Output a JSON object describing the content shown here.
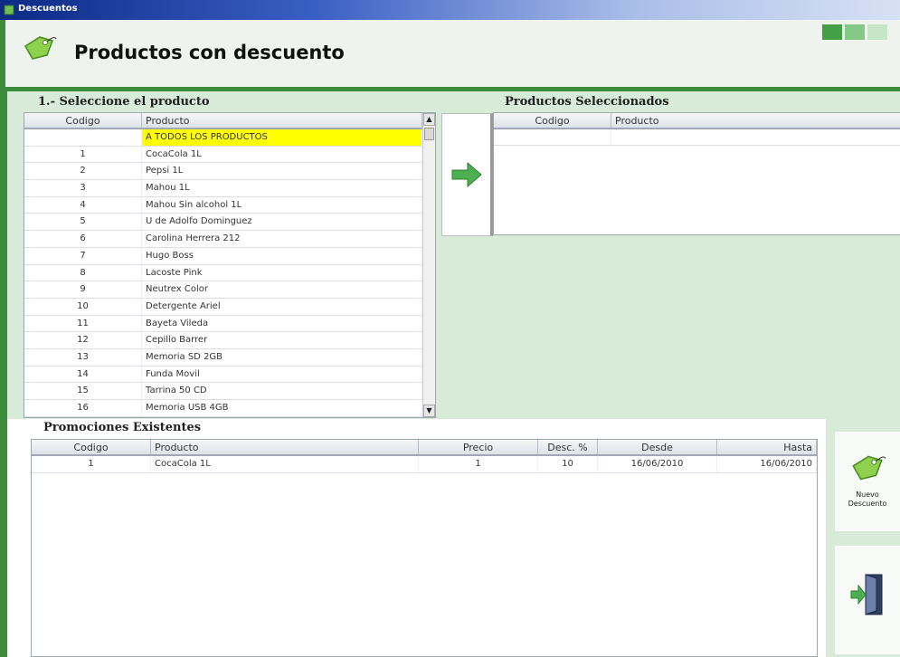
{
  "window": {
    "title": "Descuentos"
  },
  "header": {
    "title": "Productos con descuento"
  },
  "left_section": {
    "label": "1.- Seleccione el producto",
    "columns": [
      "Codigo",
      "Producto"
    ],
    "rows": [
      {
        "code": "",
        "product": "A TODOS LOS PRODUCTOS",
        "highlight": true
      },
      {
        "code": "1",
        "product": "CocaCola 1L"
      },
      {
        "code": "2",
        "product": "Pepsi 1L"
      },
      {
        "code": "3",
        "product": "Mahou 1L"
      },
      {
        "code": "4",
        "product": "Mahou Sin alcohol 1L"
      },
      {
        "code": "5",
        "product": "U de Adolfo Dominguez"
      },
      {
        "code": "6",
        "product": "Carolina Herrera 212"
      },
      {
        "code": "7",
        "product": "Hugo Boss"
      },
      {
        "code": "8",
        "product": "Lacoste Pink"
      },
      {
        "code": "9",
        "product": "Neutrex Color"
      },
      {
        "code": "10",
        "product": "Detergente Ariel"
      },
      {
        "code": "11",
        "product": "Bayeta Vileda"
      },
      {
        "code": "12",
        "product": "Cepillo Barrer"
      },
      {
        "code": "13",
        "product": "Memoria SD 2GB"
      },
      {
        "code": "14",
        "product": "Funda Movil"
      },
      {
        "code": "15",
        "product": "Tarrina 50 CD"
      },
      {
        "code": "16",
        "product": "Memoria USB 4GB"
      }
    ]
  },
  "right_section": {
    "label": "Productos Seleccionados",
    "columns": [
      "Codigo",
      "Producto"
    ]
  },
  "promotions": {
    "label": "Promociones Existentes",
    "columns": [
      "Codigo",
      "Producto",
      "Precio",
      "Desc. %",
      "Desde",
      "Hasta"
    ],
    "rows": [
      {
        "code": "1",
        "product": "CocaCola 1L",
        "price": "1",
        "discount": "10",
        "from": "16/06/2010",
        "to": "16/06/2010"
      }
    ]
  },
  "side_buttons": {
    "new_discount_line1": "Nuevo",
    "new_discount_line2": "Descuento"
  },
  "colors": {
    "accent_green": "#3b8d3b",
    "panel_green": "#d8ead8",
    "highlight_yellow": "#ffff00"
  },
  "icons": [
    "tag-icon",
    "right-arrow-icon",
    "exit-door-icon",
    "scroll-up-icon",
    "scroll-down-icon"
  ]
}
